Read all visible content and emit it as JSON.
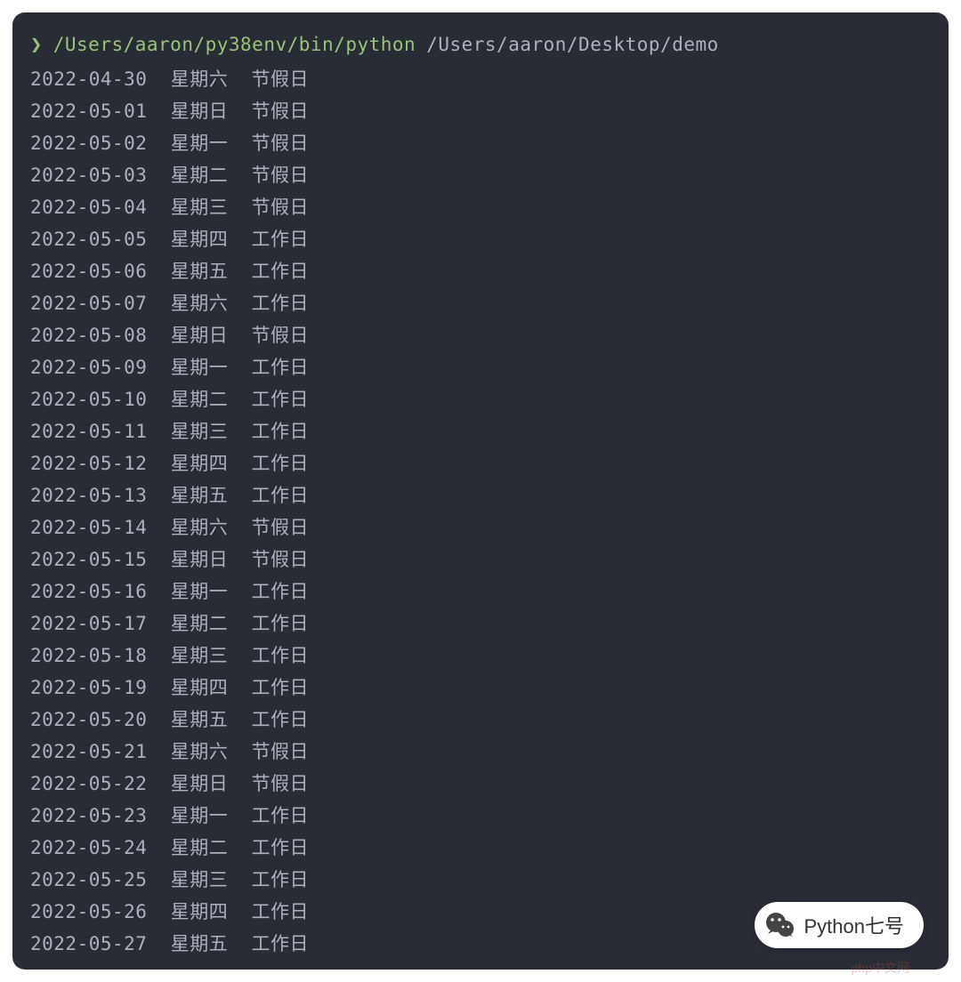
{
  "prompt": {
    "symbol": "❯",
    "command": "/Users/aaron/py38env/bin/python",
    "argument": "/Users/aaron/Desktop/demo"
  },
  "output": [
    {
      "date": "2022-04-30",
      "weekday": "星期六",
      "type": "节假日"
    },
    {
      "date": "2022-05-01",
      "weekday": "星期日",
      "type": "节假日"
    },
    {
      "date": "2022-05-02",
      "weekday": "星期一",
      "type": "节假日"
    },
    {
      "date": "2022-05-03",
      "weekday": "星期二",
      "type": "节假日"
    },
    {
      "date": "2022-05-04",
      "weekday": "星期三",
      "type": "节假日"
    },
    {
      "date": "2022-05-05",
      "weekday": "星期四",
      "type": "工作日"
    },
    {
      "date": "2022-05-06",
      "weekday": "星期五",
      "type": "工作日"
    },
    {
      "date": "2022-05-07",
      "weekday": "星期六",
      "type": "工作日"
    },
    {
      "date": "2022-05-08",
      "weekday": "星期日",
      "type": "节假日"
    },
    {
      "date": "2022-05-09",
      "weekday": "星期一",
      "type": "工作日"
    },
    {
      "date": "2022-05-10",
      "weekday": "星期二",
      "type": "工作日"
    },
    {
      "date": "2022-05-11",
      "weekday": "星期三",
      "type": "工作日"
    },
    {
      "date": "2022-05-12",
      "weekday": "星期四",
      "type": "工作日"
    },
    {
      "date": "2022-05-13",
      "weekday": "星期五",
      "type": "工作日"
    },
    {
      "date": "2022-05-14",
      "weekday": "星期六",
      "type": "节假日"
    },
    {
      "date": "2022-05-15",
      "weekday": "星期日",
      "type": "节假日"
    },
    {
      "date": "2022-05-16",
      "weekday": "星期一",
      "type": "工作日"
    },
    {
      "date": "2022-05-17",
      "weekday": "星期二",
      "type": "工作日"
    },
    {
      "date": "2022-05-18",
      "weekday": "星期三",
      "type": "工作日"
    },
    {
      "date": "2022-05-19",
      "weekday": "星期四",
      "type": "工作日"
    },
    {
      "date": "2022-05-20",
      "weekday": "星期五",
      "type": "工作日"
    },
    {
      "date": "2022-05-21",
      "weekday": "星期六",
      "type": "节假日"
    },
    {
      "date": "2022-05-22",
      "weekday": "星期日",
      "type": "节假日"
    },
    {
      "date": "2022-05-23",
      "weekday": "星期一",
      "type": "工作日"
    },
    {
      "date": "2022-05-24",
      "weekday": "星期二",
      "type": "工作日"
    },
    {
      "date": "2022-05-25",
      "weekday": "星期三",
      "type": "工作日"
    },
    {
      "date": "2022-05-26",
      "weekday": "星期四",
      "type": "工作日"
    },
    {
      "date": "2022-05-27",
      "weekday": "星期五",
      "type": "工作日"
    }
  ],
  "badge": {
    "text": "Python七号"
  },
  "watermark": "php中文网"
}
